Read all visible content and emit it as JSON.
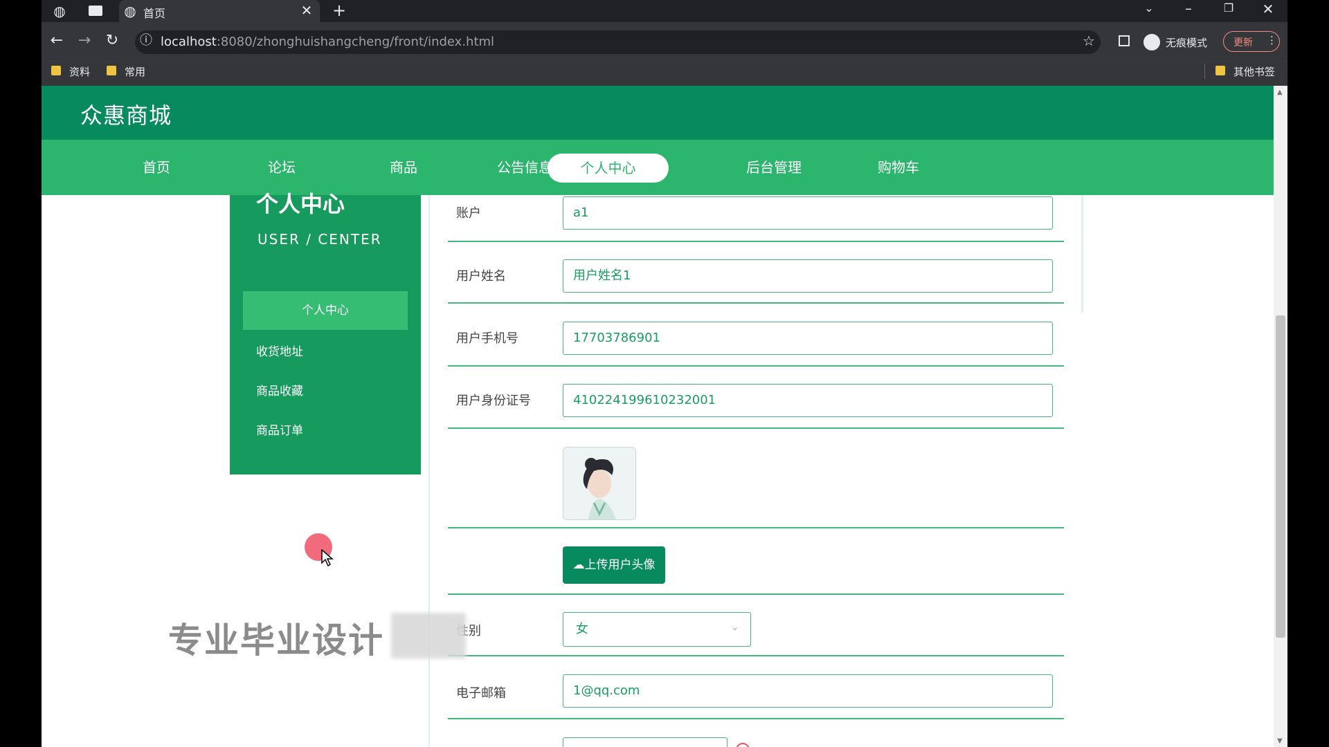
{
  "browser": {
    "tab_title": "首页",
    "url_host": "localhost",
    "url_rest": ":8080/zhonghuishangcheng/front/index.html",
    "incognito_label": "无痕模式",
    "update_label": "更新",
    "bookmarks": [
      "资料",
      "常用"
    ],
    "other_bookmarks": "其他书签"
  },
  "site": {
    "title": "众惠商城",
    "nav": [
      "首页",
      "论坛",
      "商品",
      "公告信息",
      "个人中心",
      "后台管理",
      "购物车"
    ],
    "active_nav": "个人中心"
  },
  "sidebar": {
    "title": "个人中心",
    "subtitle": "USER / CENTER",
    "items": [
      "个人中心",
      "收货地址",
      "商品收藏",
      "商品订单"
    ]
  },
  "form": {
    "account_label": "账户",
    "account_value": "a1",
    "name_label": "用户姓名",
    "name_value": "用户姓名1",
    "phone_label": "用户手机号",
    "phone_value": "17703786901",
    "id_label": "用户身份证号",
    "id_value": "410224199610232001",
    "upload_label": "上传用户头像",
    "gender_label": "性别",
    "gender_value": "女",
    "email_label": "电子邮箱",
    "email_value": "1@qq.com"
  },
  "overlay": {
    "watermark": "专业毕业设计"
  },
  "colors": {
    "header_dark": "#088a5f",
    "nav_green": "#2cb56c",
    "sidebar_green": "#169a5d",
    "field_border": "#45b97d"
  }
}
